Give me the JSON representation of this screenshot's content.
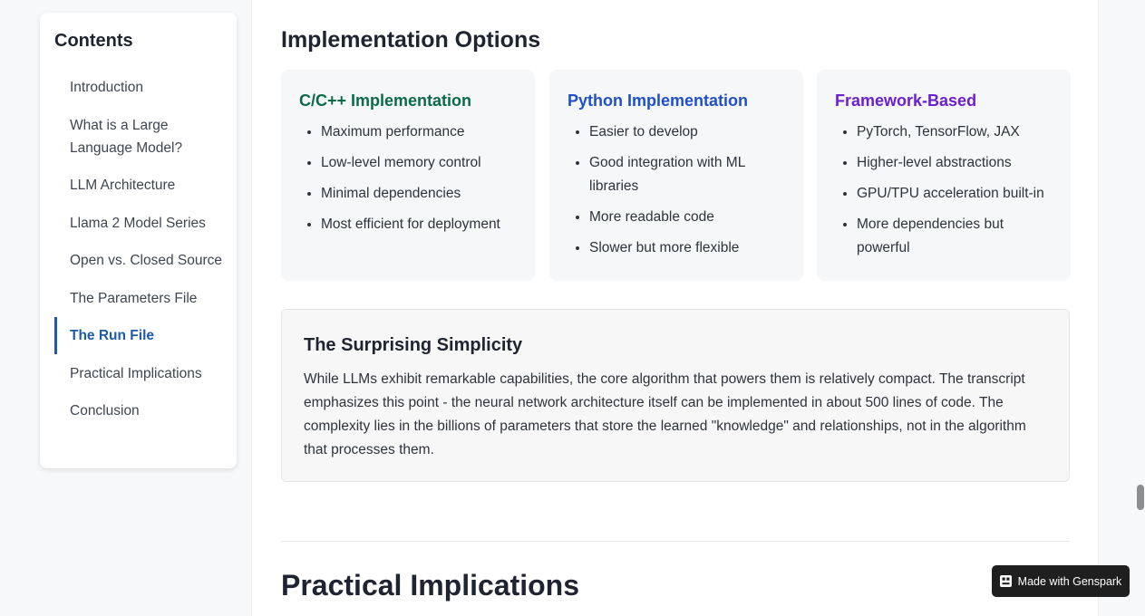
{
  "sidebar": {
    "title": "Contents",
    "items": [
      {
        "label": "Introduction",
        "active": false
      },
      {
        "label": "What is a Large Language Model?",
        "active": false
      },
      {
        "label": "LLM Architecture",
        "active": false
      },
      {
        "label": "Llama 2 Model Series",
        "active": false
      },
      {
        "label": "Open vs. Closed Source",
        "active": false
      },
      {
        "label": "The Parameters File",
        "active": false
      },
      {
        "label": "The Run File",
        "active": true
      },
      {
        "label": "Practical Implications",
        "active": false
      },
      {
        "label": "Conclusion",
        "active": false
      }
    ]
  },
  "main": {
    "section_title": "Implementation Options",
    "cards": [
      {
        "title": "C/C++ Implementation",
        "color": "#0b6b49",
        "points": [
          "Maximum performance",
          "Low-level memory control",
          "Minimal dependencies",
          "Most efficient for deployment"
        ]
      },
      {
        "title": "Python Implementation",
        "color": "#1f4fc9",
        "points": [
          "Easier to develop",
          "Good integration with ML libraries",
          "More readable code",
          "Slower but more flexible"
        ]
      },
      {
        "title": "Framework-Based",
        "color": "#6b1fd1",
        "points": [
          "PyTorch, TensorFlow, JAX",
          "Higher-level abstractions",
          "GPU/TPU acceleration built-in",
          "More dependencies but powerful"
        ]
      }
    ],
    "simplicity": {
      "title": "The Surprising Simplicity",
      "text": "While LLMs exhibit remarkable capabilities, the core algorithm that powers them is relatively compact. The transcript emphasizes this point - the neural network architecture itself can be implemented in about 500 lines of code. The complexity lies in the billions of parameters that store the learned \"knowledge\" and relationships, not in the algorithm that processes them."
    },
    "next_section_title": "Practical Implications"
  },
  "badge": {
    "label": "Made with Genspark",
    "icon": "genspark-logo-icon"
  },
  "colors": {
    "accent": "#1f5aa6"
  }
}
